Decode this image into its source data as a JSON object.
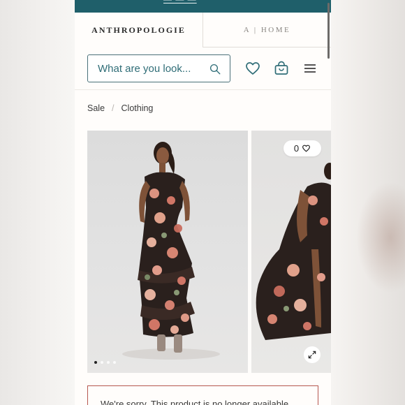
{
  "promo_bar": {
    "text": "— — —"
  },
  "site_tabs": {
    "brand": "ANTHROPOLOGIE",
    "home_logo": "A",
    "home_sep": "|",
    "home_label": "HOME"
  },
  "search": {
    "placeholder": "What are you look..."
  },
  "header_icons": [
    "heart-icon",
    "shopping-bag-icon",
    "menu-icon"
  ],
  "breadcrumb": {
    "items": [
      "Sale",
      "Clothing"
    ],
    "separator": "/"
  },
  "gallery": {
    "image_count": 4,
    "active_index": 0,
    "favorites_count": "0"
  },
  "notice": {
    "text": "We're sorry. This product is no longer available."
  },
  "colors": {
    "brand_teal": "#1f5f6a",
    "notice_border": "#b5574f",
    "text": "#2b2b2b"
  }
}
